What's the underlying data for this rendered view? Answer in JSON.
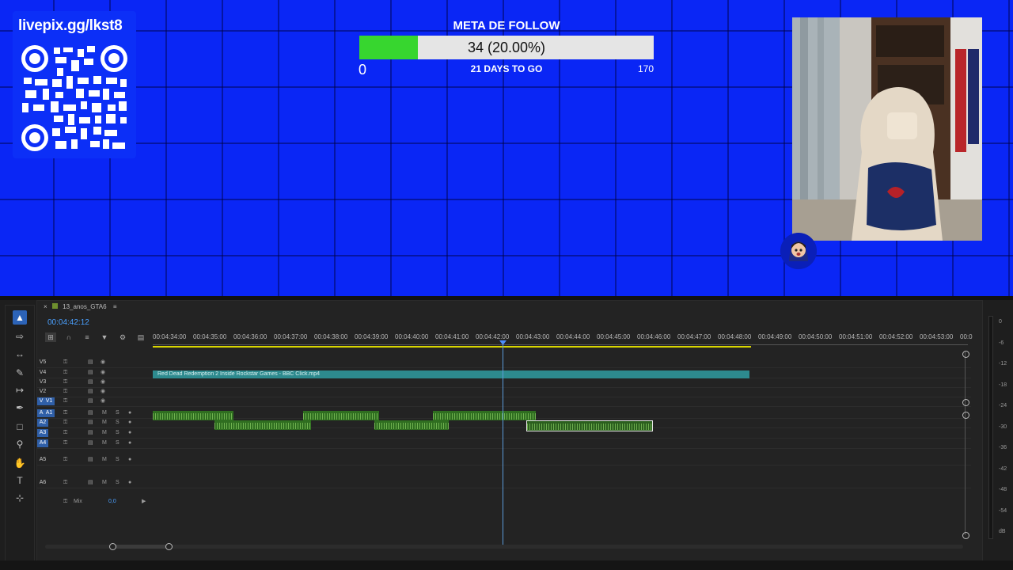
{
  "overlay": {
    "qr_url": "livepix.gg/lkst8",
    "goal": {
      "title": "META DE FOLLOW",
      "progress_text": "34 (20.00%)",
      "progress_fraction": 0.2,
      "min_label": "0",
      "max_label": "170",
      "days_label": "21 DAYS TO GO",
      "fill_color": "#37d62f"
    }
  },
  "editor": {
    "sequence_tab": "13_anos_GTA6",
    "timecode": "00:04:42:12",
    "ruler": [
      "00:04:34:00",
      "00:04:35:00",
      "00:04:36:00",
      "00:04:37:00",
      "00:04:38:00",
      "00:04:39:00",
      "00:04:40:00",
      "00:04:41:00",
      "00:04:42:00",
      "00:04:43:00",
      "00:04:44:00",
      "00:04:45:00",
      "00:04:46:00",
      "00:04:47:00",
      "00:04:48:00",
      "00:04:49:00",
      "00:04:50:00",
      "00:04:51:00",
      "00:04:52:00",
      "00:04:53:00",
      "00:0"
    ],
    "video_tracks": [
      "V5",
      "V4",
      "V3",
      "V2",
      "V1"
    ],
    "audio_tracks": [
      "A1",
      "A2",
      "A3",
      "A4",
      "A5",
      "A6"
    ],
    "source_v": "V1",
    "source_a": "A1",
    "mute_label": "M",
    "solo_label": "S",
    "mix_label": "Mix",
    "mix_value": "0,0",
    "video_clip": "Red Dead Redemption 2 Inside Rockstar Games  - BBC Click.mp4",
    "meter_labels": [
      "0",
      "-6",
      "-12",
      "-18",
      "-24",
      "-30",
      "-36",
      "-42",
      "-48",
      "-54",
      "dB"
    ]
  }
}
